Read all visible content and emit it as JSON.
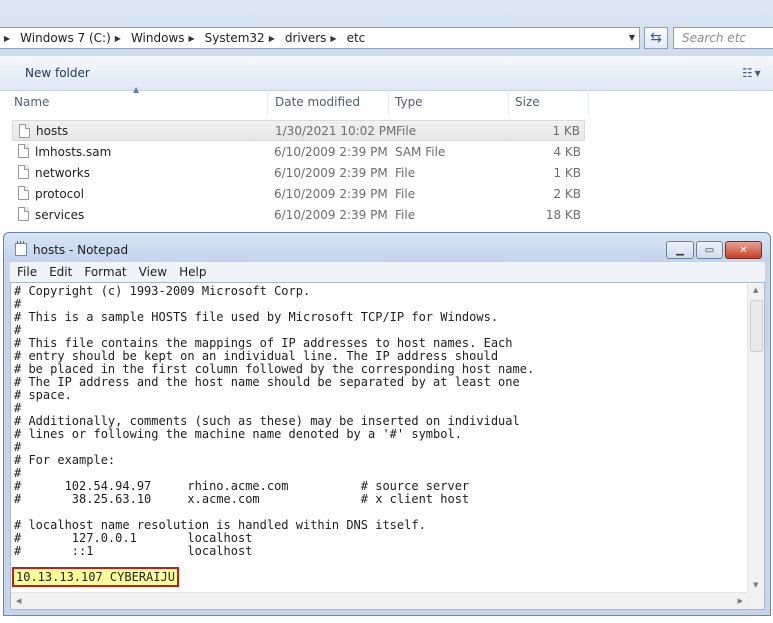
{
  "explorer": {
    "breadcrumbs": [
      "Windows 7 (C:)",
      "Windows",
      "System32",
      "drivers",
      "etc"
    ],
    "search_placeholder": "Search etc",
    "toolbar": {
      "new_folder": "New folder"
    },
    "columns": {
      "name": "Name",
      "date": "Date modified",
      "type": "Type",
      "size": "Size"
    },
    "files": [
      {
        "name": "hosts",
        "date": "1/30/2021 10:02 PM",
        "type": "File",
        "size": "1 KB",
        "selected": true
      },
      {
        "name": "lmhosts.sam",
        "date": "6/10/2009 2:39 PM",
        "type": "SAM File",
        "size": "4 KB"
      },
      {
        "name": "networks",
        "date": "6/10/2009 2:39 PM",
        "type": "File",
        "size": "1 KB"
      },
      {
        "name": "protocol",
        "date": "6/10/2009 2:39 PM",
        "type": "File",
        "size": "2 KB"
      },
      {
        "name": "services",
        "date": "6/10/2009 2:39 PM",
        "type": "File",
        "size": "18 KB"
      }
    ]
  },
  "notepad": {
    "title": "hosts - Notepad",
    "menu": [
      "File",
      "Edit",
      "Format",
      "View",
      "Help"
    ],
    "content": "# Copyright (c) 1993-2009 Microsoft Corp.\n#\n# This is a sample HOSTS file used by Microsoft TCP/IP for Windows.\n#\n# This file contains the mappings of IP addresses to host names. Each\n# entry should be kept on an individual line. The IP address should\n# be placed in the first column followed by the corresponding host name.\n# The IP address and the host name should be separated by at least one\n# space.\n#\n# Additionally, comments (such as these) may be inserted on individual\n# lines or following the machine name denoted by a '#' symbol.\n#\n# For example:\n#\n#      102.54.94.97     rhino.acme.com          # source server\n#       38.25.63.10     x.acme.com              # x client host\n\n# localhost name resolution is handled within DNS itself.\n#\t127.0.0.1       localhost\n#\t::1             localhost",
    "highlighted_line": "10.13.13.107 CYBERAIJU",
    "highlight_color": "#ffff99",
    "highlight_border": "#c21d1d"
  }
}
